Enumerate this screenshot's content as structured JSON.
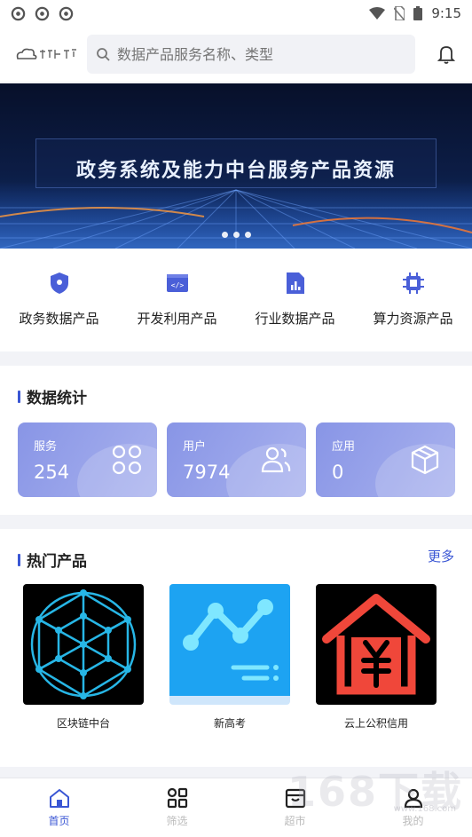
{
  "status_bar": {
    "time": "9:15"
  },
  "header": {
    "search_placeholder": "数据产品服务名称、类型"
  },
  "banner": {
    "title": "政务系统及能力中台服务产品资源"
  },
  "categories": [
    {
      "label": "政务数据产品",
      "icon": "shield-icon"
    },
    {
      "label": "开发利用产品",
      "icon": "code-window-icon"
    },
    {
      "label": "行业数据产品",
      "icon": "chart-document-icon"
    },
    {
      "label": "算力资源产品",
      "icon": "chip-icon"
    }
  ],
  "stats": {
    "title": "数据统计",
    "cards": [
      {
        "label": "服务",
        "value": "254",
        "icon": "grid-icon"
      },
      {
        "label": "用户",
        "value": "7974",
        "icon": "users-icon"
      },
      {
        "label": "应用",
        "value": "0",
        "icon": "box-icon"
      }
    ]
  },
  "hot": {
    "title": "热门产品",
    "more_label": "更多",
    "products": [
      {
        "name": "区块链中台"
      },
      {
        "name": "新高考"
      },
      {
        "name": "云上公积信用"
      }
    ]
  },
  "nav": {
    "items": [
      {
        "label": "首页",
        "icon": "home-icon",
        "active": true
      },
      {
        "label": "筛选",
        "icon": "filter-grid-icon",
        "active": false
      },
      {
        "label": "超市",
        "icon": "store-icon",
        "active": false
      },
      {
        "label": "我的",
        "icon": "user-icon",
        "active": false
      }
    ]
  },
  "watermark": {
    "text": "168下载",
    "sub": "www.168.com"
  },
  "colors": {
    "accent": "#3a56d4",
    "card_start": "#8895e6",
    "card_end": "#a9b2ee"
  }
}
